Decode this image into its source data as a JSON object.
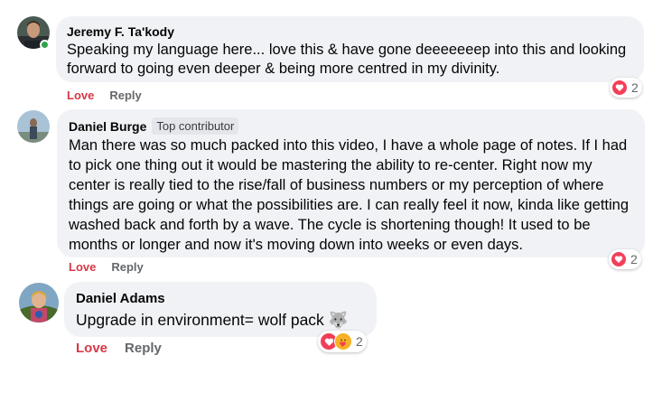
{
  "comments": [
    {
      "author": "Jeremy F. Ta'kody",
      "text": "Speaking my language here... love this & have gone deeeeeeep into this and looking forward to going even deeper & being more centred in my divinity.",
      "love_label": "Love",
      "reply_label": "Reply",
      "reaction_count": "2",
      "reaction_icons": [
        "heart-icon"
      ],
      "online": true
    },
    {
      "author": "Daniel Burge",
      "badge": "Top contributor",
      "text": "Man there was so much packed into this video, I have a whole page of notes. If I had to pick one thing out it would be mastering the ability to re-center. Right now my center is really tied to the rise/fall of business numbers or my perception of where things are going or what the possibilities are. I can really feel it now, kinda like getting washed back and forth by a wave. The cycle is shortening though! It used to be months or longer and now it's moving down into weeks or even days.",
      "love_label": "Love",
      "reply_label": "Reply",
      "reaction_count": "2",
      "reaction_icons": [
        "heart-icon"
      ]
    },
    {
      "author": "Daniel Adams",
      "text": "Upgrade in environment= wolf pack 🐺",
      "love_label": "Love",
      "reply_label": "Reply",
      "reaction_count": "2",
      "reaction_icons": [
        "heart-icon",
        "care-icon"
      ]
    }
  ],
  "colors": {
    "bubble_bg": "#f0f2f5",
    "love_red": "#d63946",
    "reply_gray": "#65676b",
    "heart_red": "#f33e58",
    "online_green": "#31a24c"
  }
}
